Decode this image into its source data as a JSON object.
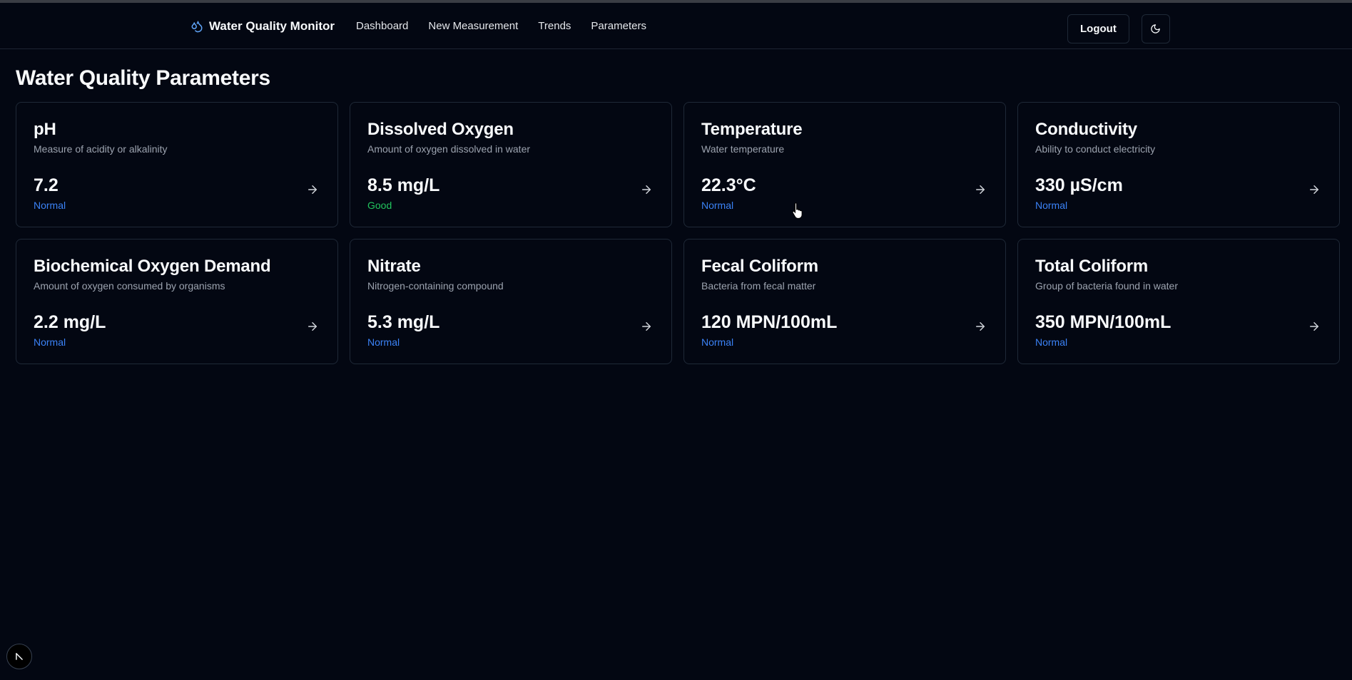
{
  "header": {
    "brand_icon": "droplets-icon",
    "brand_title": "Water Quality Monitor",
    "nav": [
      {
        "label": "Dashboard"
      },
      {
        "label": "New Measurement"
      },
      {
        "label": "Trends"
      },
      {
        "label": "Parameters"
      }
    ],
    "logout_label": "Logout",
    "theme_icon": "moon-icon"
  },
  "page": {
    "title": "Water Quality Parameters"
  },
  "colors": {
    "background": "#030712",
    "accent": "#3b82f6",
    "status_normal": "#3b82f6",
    "status_good": "#22c55e"
  },
  "parameters": [
    {
      "name": "pH",
      "description": "Measure of acidity or alkalinity",
      "value": "7.2",
      "status": "Normal",
      "status_color": "#3b82f6"
    },
    {
      "name": "Dissolved Oxygen",
      "description": "Amount of oxygen dissolved in water",
      "value": "8.5 mg/L",
      "status": "Good",
      "status_color": "#22c55e"
    },
    {
      "name": "Temperature",
      "description": "Water temperature",
      "value": "22.3°C",
      "status": "Normal",
      "status_color": "#3b82f6"
    },
    {
      "name": "Conductivity",
      "description": "Ability to conduct electricity",
      "value": "330 µS/cm",
      "status": "Normal",
      "status_color": "#3b82f6"
    },
    {
      "name": "Biochemical Oxygen Demand",
      "description": "Amount of oxygen consumed by organisms",
      "value": "2.2 mg/L",
      "status": "Normal",
      "status_color": "#3b82f6"
    },
    {
      "name": "Nitrate",
      "description": "Nitrogen-containing compound",
      "value": "5.3 mg/L",
      "status": "Normal",
      "status_color": "#3b82f6"
    },
    {
      "name": "Fecal Coliform",
      "description": "Bacteria from fecal matter",
      "value": "120 MPN/100mL",
      "status": "Normal",
      "status_color": "#3b82f6"
    },
    {
      "name": "Total Coliform",
      "description": "Group of bacteria found in water",
      "value": "350 MPN/100mL",
      "status": "Normal",
      "status_color": "#3b82f6"
    }
  ],
  "card_arrow_icon": "arrow-right-icon",
  "corner_icon": "arrow-up-left-icon"
}
